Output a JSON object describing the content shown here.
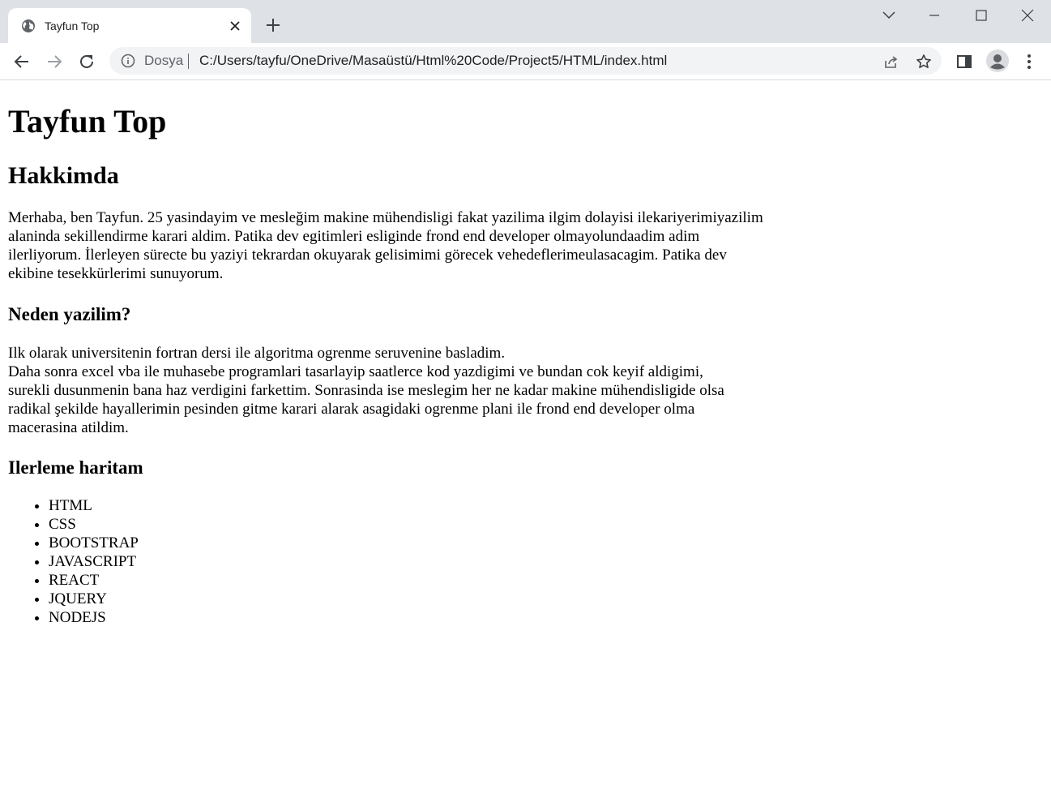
{
  "browser": {
    "tab_title": "Tayfun Top",
    "address_scheme_label": "Dosya",
    "address_url": "C:/Users/tayfu/OneDrive/Masaüstü/Html%20Code/Project5/HTML/index.html"
  },
  "icons": {
    "favicon": "globe-icon",
    "tab_close": "close-icon",
    "new_tab": "plus-icon",
    "tab_search": "chevron-down-icon",
    "minimize": "minimize-icon",
    "maximize": "maximize-icon",
    "close_window": "close-icon",
    "back": "arrow-left-icon",
    "forward": "arrow-right-icon",
    "reload": "reload-icon",
    "site_info": "info-icon",
    "share": "share-icon",
    "bookmark": "star-icon",
    "side_panel": "side-panel-icon",
    "profile": "profile-icon",
    "menu": "kebab-menu-icon"
  },
  "page": {
    "title": "Tayfun Top",
    "about_heading": "Hakkimda",
    "about_lines": [
      "Merhaba, ben Tayfun. 25 yasindayim ve mesleğim makine mühendisligi fakat yazilima ilgim dolayisi ilekariyerimiyazilim",
      "alaninda sekillendirme karari aldim. Patika dev egitimleri esliginde frond end developer olmayolundaadim adim",
      "ilerliyorum. İlerleyen sürecte bu yaziyi tekrardan okuyarak gelisimimi görecek vehedeflerimeulasacagim. Patika dev",
      "ekibine tesekkürlerimi sunuyorum."
    ],
    "why_heading": "Neden yazilim?",
    "why_lines": [
      "Ilk olarak universitenin fortran dersi ile algoritma ogrenme seruvenine basladim.",
      "Daha sonra excel vba ile muhasebe programlari tasarlayip saatlerce kod yazdigimi ve bundan cok keyif aldigimi,",
      "surekli dusunmenin bana haz verdigini farkettim. Sonrasinda ise meslegim her ne kadar makine mühendisligide olsa",
      "radikal şekilde hayallerimin pesinden gitme karari alarak asagidaki ogrenme plani ile frond end developer olma",
      "macerasina atildim."
    ],
    "roadmap_heading": "Ilerleme haritam",
    "roadmap_items": [
      "HTML",
      "CSS",
      "BOOTSTRAP",
      "JAVASCRIPT",
      "REACT",
      "JQUERY",
      "NODEJS"
    ]
  }
}
